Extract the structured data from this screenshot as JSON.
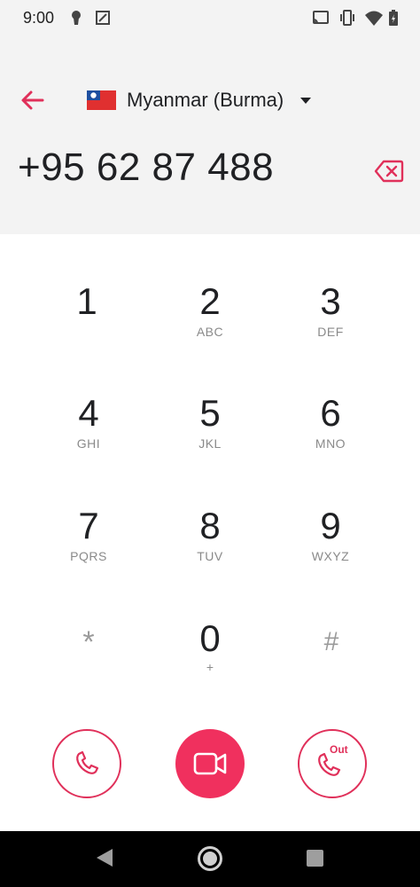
{
  "status_bar": {
    "time": "9:00",
    "icons": [
      "keyhole-icon",
      "screenshot-icon",
      "cast-icon",
      "vibrate-icon",
      "wifi-icon",
      "battery-icon"
    ]
  },
  "header": {
    "back_icon": "arrow-left-icon",
    "country": {
      "name": "Myanmar (Burma)",
      "flag": "myanmar-flag"
    },
    "dropdown_icon": "caret-down-icon",
    "phone_number": "+95 62 87 488",
    "backspace_icon": "backspace-icon"
  },
  "keypad": {
    "keys": [
      {
        "digit": "1",
        "letters": ""
      },
      {
        "digit": "2",
        "letters": "ABC"
      },
      {
        "digit": "3",
        "letters": "DEF"
      },
      {
        "digit": "4",
        "letters": "GHI"
      },
      {
        "digit": "5",
        "letters": "JKL"
      },
      {
        "digit": "6",
        "letters": "MNO"
      },
      {
        "digit": "7",
        "letters": "PQRS"
      },
      {
        "digit": "8",
        "letters": "TUV"
      },
      {
        "digit": "9",
        "letters": "WXYZ"
      },
      {
        "digit": "*",
        "letters": ""
      },
      {
        "digit": "0",
        "letters": "+"
      },
      {
        "digit": "#",
        "letters": ""
      }
    ]
  },
  "actions": {
    "call_icon": "phone-icon",
    "video_icon": "video-camera-icon",
    "callout_icon": "phone-out-icon",
    "callout_label": "Out"
  },
  "nav": {
    "icons": [
      "back-triangle-icon",
      "home-circle-icon",
      "recents-square-icon"
    ]
  },
  "colors": {
    "accent": "#e0305a",
    "accent_fill": "#f0305e",
    "header_bg": "#f3f3f3"
  }
}
